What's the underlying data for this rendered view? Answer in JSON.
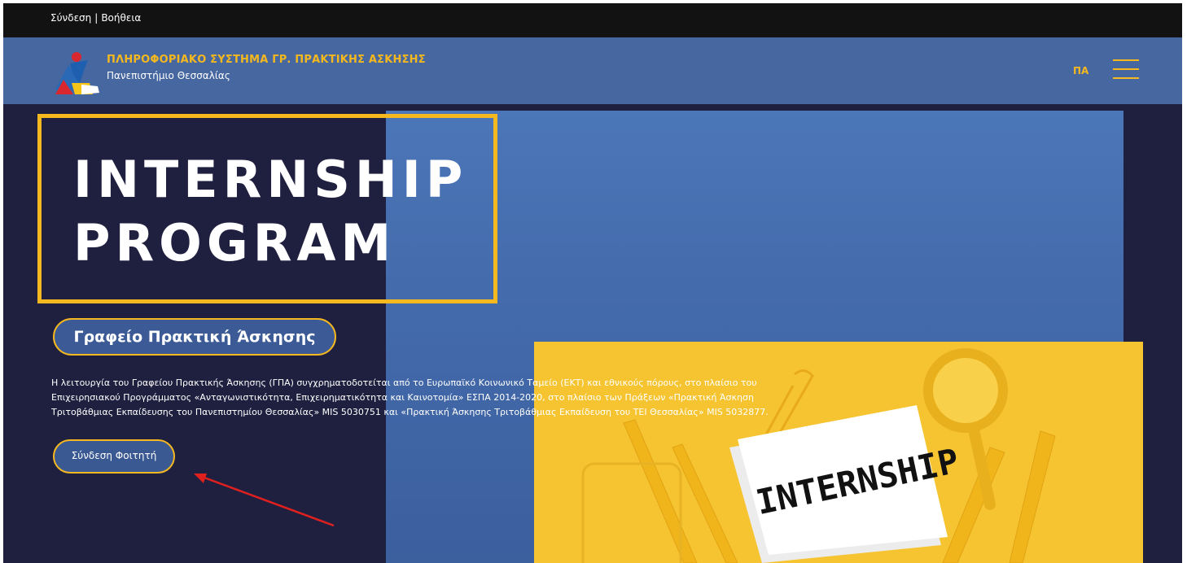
{
  "topbar": {
    "login": "Σύνδεση",
    "separator": "|",
    "help": "Βοήθεια"
  },
  "header": {
    "title": "ΠΛΗΡΟΦΟΡΙΑΚΟ ΣΥΣΤΗΜΑ ΓΡ. ΠΡΑΚΤΙΚΗΣ ΑΣΚΗΣΗΣ",
    "subtitle": "Πανεπιστήμιο Θεσσαλίας",
    "lang": "ΠΑ",
    "menu_icon": "hamburger-icon"
  },
  "hero": {
    "title_line1": "INTERNSHIP",
    "title_line2": "PROGRAM",
    "office_label": "Γραφείο Πρακτική Άσκησης",
    "description": "Η λειτουργία του Γραφείου Πρακτικής Άσκησης (ΓΠΑ) συγχρηματοδοτείται από το Ευρωπαϊκό Κοινωνικό Ταμείο (ΕΚΤ) και εθνικούς πόρους, στο πλαίσιο του Επιχειρησιακού Προγράμματος «Ανταγωνιστικότητα, Επιχειρηματικότητα και Καινοτομία» ΕΣΠΑ 2014-2020, στο πλαίσιο των Πράξεων «Πρακτική Άσκηση Τριτοβάθμιας Εκπαίδευσης του Πανεπιστημίου Θεσσαλίας» MIS 5030751 και «Πρακτική Άσκησης Τριτοβάθμιας Εκπαίδευση του ΤΕΙ Θεσσαλίας» MIS 5032877.",
    "login_button": "Σύνδεση Φοιτητή",
    "photo_text": "INTERNSHIP"
  },
  "colors": {
    "accent": "#f5b81f",
    "header_bg": "#4667a0",
    "dark_bg": "#1f2040",
    "annotation_arrow": "#e0201f"
  }
}
